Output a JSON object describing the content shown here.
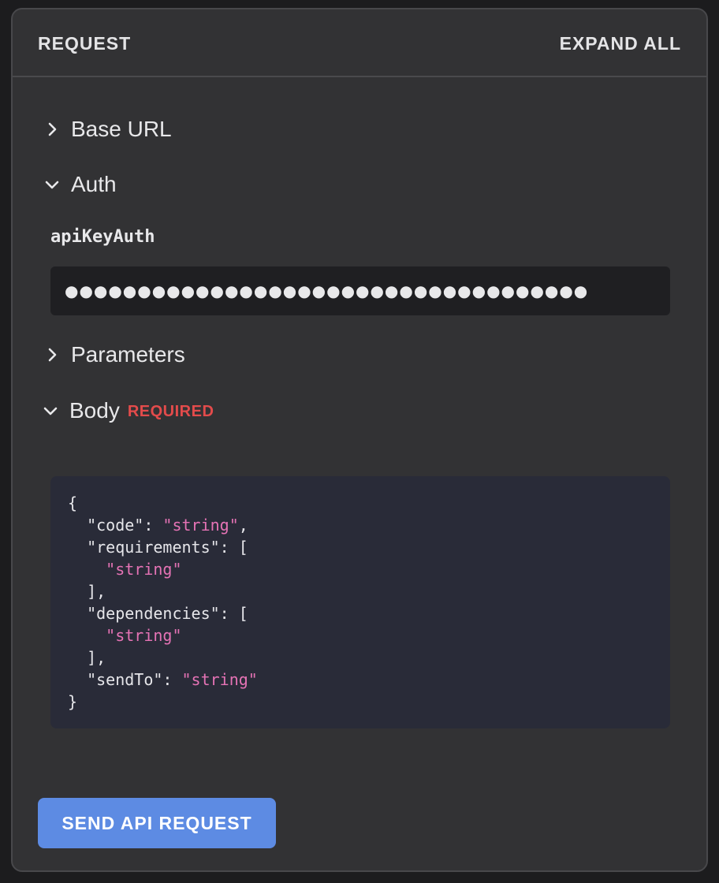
{
  "header": {
    "title": "REQUEST",
    "expand_all_label": "EXPAND ALL"
  },
  "sections": {
    "base_url": {
      "label": "Base URL",
      "state": "collapsed"
    },
    "auth": {
      "label": "Auth",
      "state": "expanded"
    },
    "parameters": {
      "label": "Parameters",
      "state": "collapsed"
    },
    "body": {
      "label": "Body",
      "state": "expanded",
      "badge": "REQUIRED"
    }
  },
  "auth": {
    "scheme_name": "apiKeyAuth",
    "input_value": "●●●●●●●●●●●●●●●●●●●●●●●●●●●●●●●●●●●●"
  },
  "body_code": {
    "lines": [
      [
        {
          "t": "{",
          "c": "p"
        }
      ],
      [
        {
          "t": "  \"code\": ",
          "c": "p"
        },
        {
          "t": "\"string\"",
          "c": "s"
        },
        {
          "t": ",",
          "c": "p"
        }
      ],
      [
        {
          "t": "  \"requirements\": [",
          "c": "p"
        }
      ],
      [
        {
          "t": "    ",
          "c": "p"
        },
        {
          "t": "\"string\"",
          "c": "s"
        }
      ],
      [
        {
          "t": "  ],",
          "c": "p"
        }
      ],
      [
        {
          "t": "  \"dependencies\": [",
          "c": "p"
        }
      ],
      [
        {
          "t": "    ",
          "c": "p"
        },
        {
          "t": "\"string\"",
          "c": "s"
        }
      ],
      [
        {
          "t": "  ],",
          "c": "p"
        }
      ],
      [
        {
          "t": "  \"sendTo\": ",
          "c": "p"
        },
        {
          "t": "\"string\"",
          "c": "s"
        }
      ],
      [
        {
          "t": "}",
          "c": "p"
        }
      ]
    ]
  },
  "actions": {
    "send_label": "SEND API REQUEST"
  },
  "colors": {
    "panel_bg": "#323234",
    "required": "#e34b4b",
    "string_token": "#e573b5",
    "send_button": "#5d8be3"
  }
}
